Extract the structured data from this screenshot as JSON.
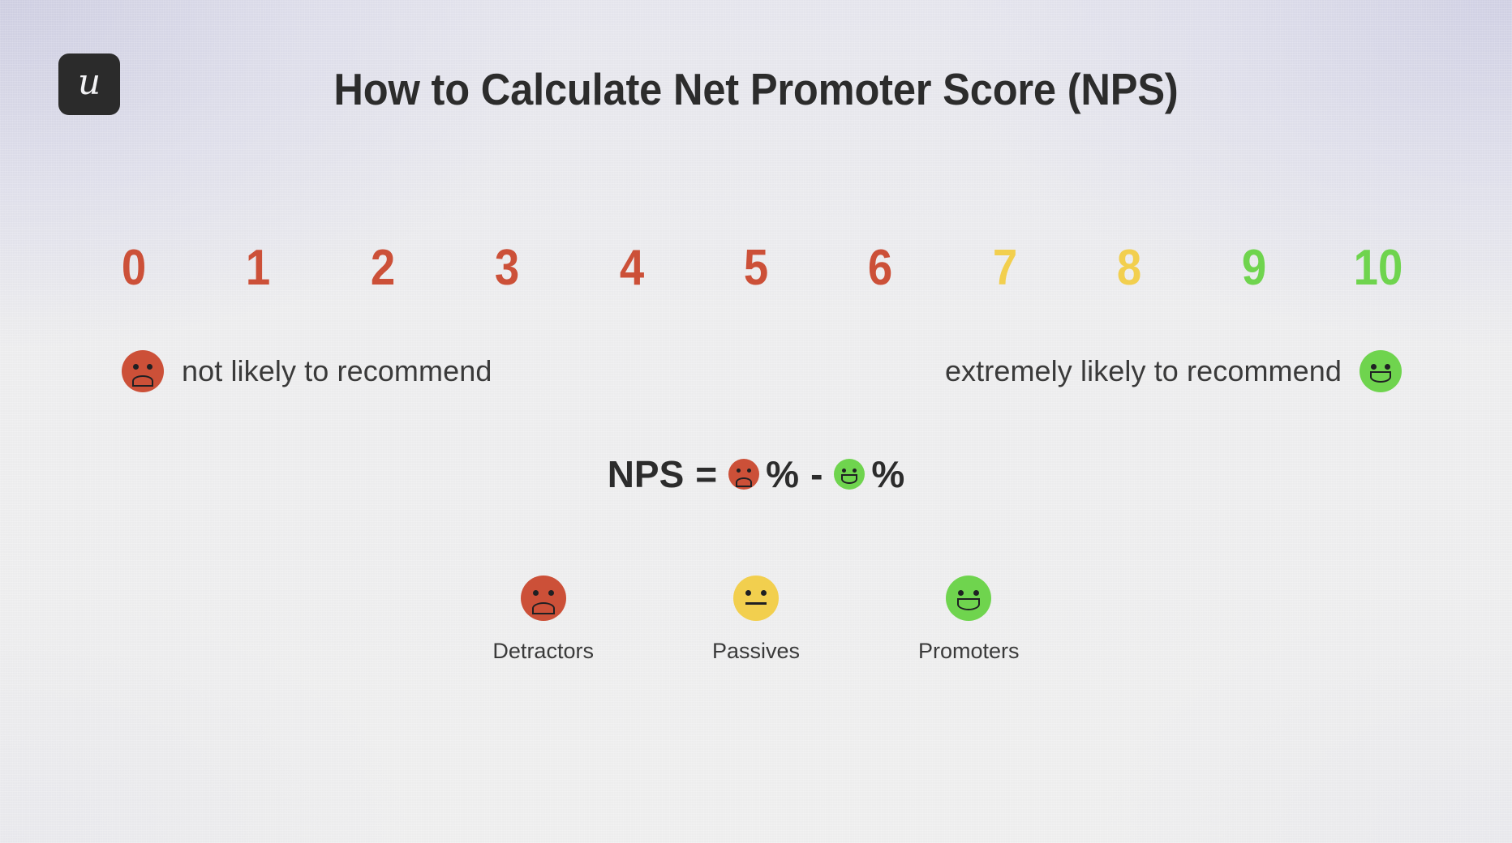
{
  "brand": {
    "logo_glyph": "u",
    "logo_bg": "#2b2b2b"
  },
  "header": {
    "title": "How to Calculate Net Promoter Score (NPS)"
  },
  "colors": {
    "detractor": "#cc5038",
    "passive": "#f2cf4e",
    "promoter": "#6fd44e",
    "text_dark": "#2c2c2c",
    "text_body": "#3a3a3a",
    "background_top": "#dcdce6",
    "background_base": "#eeeeee"
  },
  "scale": {
    "items": [
      {
        "value": "0",
        "color": "#cc5038"
      },
      {
        "value": "1",
        "color": "#cc5038"
      },
      {
        "value": "2",
        "color": "#cc5038"
      },
      {
        "value": "3",
        "color": "#cc5038"
      },
      {
        "value": "4",
        "color": "#cc5038"
      },
      {
        "value": "5",
        "color": "#cc5038"
      },
      {
        "value": "6",
        "color": "#cc5038"
      },
      {
        "value": "7",
        "color": "#f2cf4e"
      },
      {
        "value": "8",
        "color": "#f2cf4e"
      },
      {
        "value": "9",
        "color": "#6fd44e"
      },
      {
        "value": "10",
        "color": "#6fd44e"
      }
    ]
  },
  "anchors": {
    "left": {
      "label": "not likely to recommend",
      "face": "sad-face-icon",
      "face_color": "#cc5038"
    },
    "right": {
      "label": "extremely likely to recommend",
      "face": "happy-face-icon",
      "face_color": "#6fd44e"
    }
  },
  "formula": {
    "lead": "NPS",
    "equals": "=",
    "percent_1": "%",
    "minus": "-",
    "percent_2": "%",
    "sad_face_color": "#cc5038",
    "happy_face_color": "#6fd44e"
  },
  "categories": [
    {
      "label": "Detractors",
      "face": "sad-face-icon",
      "color": "#cc5038",
      "mouth": "frown"
    },
    {
      "label": "Passives",
      "face": "neutral-face-icon",
      "color": "#f2cf4e",
      "mouth": "flat"
    },
    {
      "label": "Promoters",
      "face": "happy-face-icon",
      "color": "#6fd44e",
      "mouth": "smile"
    }
  ]
}
